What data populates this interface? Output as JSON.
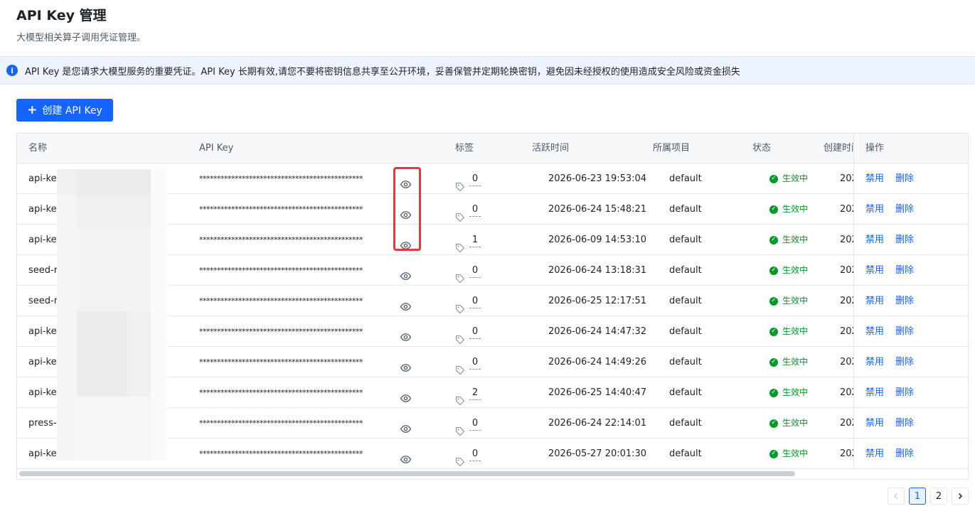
{
  "page": {
    "title": "API Key 管理",
    "subtitle": "大模型相关算子调用凭证管理。"
  },
  "notice": {
    "icon": "info-icon",
    "text": "API Key 是您请求大模型服务的重要凭证。API Key 长期有效,请您不要将密钥信息共享至公开环境，妥善保管并定期轮换密钥，避免因未经授权的使用造成安全风险或资金损失"
  },
  "create_button": {
    "label": "创建 API Key",
    "icon": "plus-icon"
  },
  "table": {
    "columns": [
      "名称",
      "API Key",
      "标签",
      "活跃时间",
      "所属项目",
      "状态",
      "创建时间",
      "操作"
    ],
    "rows": [
      {
        "name": "api-ke",
        "key": "**********************************************",
        "tags": "0",
        "active": "2026-06-23 19:53:04",
        "project": "default",
        "status": "生效中",
        "created": "202",
        "op1": "禁用",
        "op2": "删除"
      },
      {
        "name": "api-ke",
        "key": "**********************************************",
        "tags": "0",
        "active": "2026-06-24 15:48:21",
        "project": "default",
        "status": "生效中",
        "created": "202",
        "op1": "禁用",
        "op2": "删除"
      },
      {
        "name": "api-ke",
        "key": "**********************************************",
        "tags": "1",
        "active": "2026-06-09 14:53:10",
        "project": "default",
        "status": "生效中",
        "created": "202",
        "op1": "禁用",
        "op2": "删除"
      },
      {
        "name": "seed-r",
        "key": "**********************************************",
        "tags": "0",
        "active": "2026-06-24 13:18:31",
        "project": "default",
        "status": "生效中",
        "created": "202",
        "op1": "禁用",
        "op2": "删除"
      },
      {
        "name": "seed-r",
        "key": "**********************************************",
        "tags": "0",
        "active": "2026-06-25 12:17:51",
        "project": "default",
        "status": "生效中",
        "created": "202",
        "op1": "禁用",
        "op2": "删除"
      },
      {
        "name": "api-ke",
        "key": "**********************************************",
        "tags": "0",
        "active": "2026-06-24 14:47:32",
        "project": "default",
        "status": "生效中",
        "created": "202",
        "op1": "禁用",
        "op2": "删除"
      },
      {
        "name": "api-ke",
        "key": "**********************************************",
        "tags": "0",
        "active": "2026-06-24 14:49:26",
        "project": "default",
        "status": "生效中",
        "created": "202",
        "op1": "禁用",
        "op2": "删除"
      },
      {
        "name": "api-ke",
        "key": "**********************************************",
        "tags": "2",
        "active": "2026-06-25 14:40:47",
        "project": "default",
        "status": "生效中",
        "created": "202",
        "op1": "禁用",
        "op2": "删除"
      },
      {
        "name": "press-",
        "key": "**********************************************",
        "tags": "0",
        "active": "2026-06-24 22:14:01",
        "project": "default",
        "status": "生效中",
        "created": "202",
        "op1": "禁用",
        "op2": "删除"
      },
      {
        "name": "api-ke",
        "key": "**********************************************",
        "tags": "0",
        "active": "2026-05-27 20:01:30",
        "project": "default",
        "status": "生效中",
        "created": "202",
        "op1": "禁用",
        "op2": "删除"
      }
    ]
  },
  "pagination": {
    "pages": [
      "1",
      "2"
    ],
    "current": "1",
    "prev_icon": "chevron-left-icon",
    "next_icon": "chevron-right-icon"
  },
  "colors": {
    "primary": "#1664ff",
    "success": "#009a29",
    "highlight": "#e5383b",
    "notice_bg": "#eef4ff"
  }
}
